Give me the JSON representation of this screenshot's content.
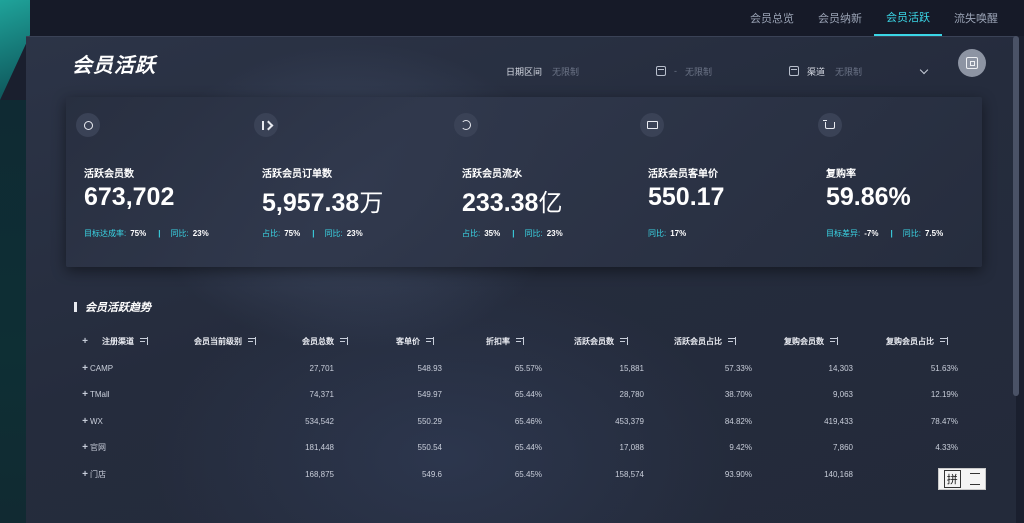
{
  "nav": {
    "tabs": [
      {
        "label": "会员总览",
        "active": false
      },
      {
        "label": "会员纳新",
        "active": false
      },
      {
        "label": "会员活跃",
        "active": true
      },
      {
        "label": "流失唤醒",
        "active": false
      }
    ]
  },
  "page": {
    "title": "会员活跃"
  },
  "filters": {
    "date_label": "日期区间",
    "date_start_placeholder": "无限制",
    "date_separator": "-",
    "date_end_placeholder": "无限制",
    "channel_label": "渠道",
    "channel_value": "无限制"
  },
  "kpis": [
    {
      "icon": "coin-icon",
      "label": "活跃会员数",
      "value": "673,702",
      "unit": "",
      "subs": [
        {
          "k": "目标达成率:",
          "v": "75%"
        },
        {
          "k": "同比:",
          "v": "23%"
        }
      ]
    },
    {
      "icon": "order-icon",
      "label": "活跃会员订单数",
      "value": "5,957.38",
      "unit": "万",
      "subs": [
        {
          "k": "占比:",
          "v": "75%"
        },
        {
          "k": "同比:",
          "v": "23%"
        }
      ]
    },
    {
      "icon": "cycle-icon",
      "label": "活跃会员流水",
      "value": "233.38",
      "unit": "亿",
      "subs": [
        {
          "k": "占比:",
          "v": "35%"
        },
        {
          "k": "同比:",
          "v": "23%"
        }
      ]
    },
    {
      "icon": "wallet-icon",
      "label": "活跃会员客单价",
      "value": "550.17",
      "unit": "",
      "subs": [
        {
          "k": "同比:",
          "v": "17%"
        }
      ]
    },
    {
      "icon": "cart-icon",
      "label": "复购率",
      "value": "59.86%",
      "unit": "",
      "subs": [
        {
          "k": "目标差异:",
          "v": "-7%"
        },
        {
          "k": "同比:",
          "v": "7.5%"
        }
      ]
    }
  ],
  "section": {
    "title": "会员活跃趋势"
  },
  "table": {
    "columns": [
      "注册渠道",
      "会员当前级别",
      "会员总数",
      "客单价",
      "折扣率",
      "活跃会员数",
      "活跃会员占比",
      "复购会员数",
      "复购会员占比"
    ],
    "rows": [
      [
        "CAMP",
        "",
        "27,701",
        "548.93",
        "65.57%",
        "15,881",
        "57.33%",
        "14,303",
        "51.63%"
      ],
      [
        "TMall",
        "",
        "74,371",
        "549.97",
        "65.44%",
        "28,780",
        "38.70%",
        "9,063",
        "12.19%"
      ],
      [
        "WX",
        "",
        "534,542",
        "550.29",
        "65.46%",
        "453,379",
        "84.82%",
        "419,433",
        "78.47%"
      ],
      [
        "官网",
        "",
        "181,448",
        "550.54",
        "65.44%",
        "17,088",
        "9.42%",
        "7,860",
        "4.33%"
      ],
      [
        "门店",
        "",
        "168,875",
        "549.6",
        "65.45%",
        "158,574",
        "93.90%",
        "140,168",
        ""
      ]
    ]
  },
  "ime": {
    "char": "拼"
  },
  "colors": {
    "accent": "#3ad6e6",
    "panel": "#2a3143",
    "background": "#161a28"
  }
}
